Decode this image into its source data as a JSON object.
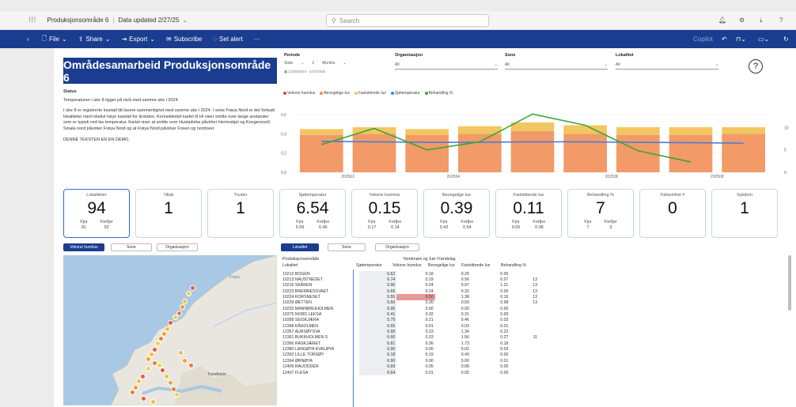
{
  "topbar": {
    "app_title": "Produksjonsområde 6",
    "data_updated": "Data updated 2/27/25",
    "search_placeholder": "Search"
  },
  "menubar": {
    "file": "File",
    "share": "Share",
    "export": "Export",
    "subscribe": "Subscribe",
    "set_alert": "Set alert",
    "more": "···",
    "copilot": "Copilot"
  },
  "report": {
    "title": "Områdesamarbeid Produksjonsområde 6",
    "help": "?",
    "status_heading": "Status",
    "status_line1": "Temperaturen i uke 8 ligger på nivå med samme uke i 2024.",
    "status_para": "I uke 8 er registrerte lusetall litt lavere sammenlignet med samme uke i 2024. I sone Frøya Nord er det fortsatt lokaliteter med relativt høye lusetall for årstiden. Konnektivitet kartet til HI viser smitte over lange avstander som er typisk ved lav temperatur. Kartet viser at smitte over Hustadvika påvirker Hemnskjel og Kongensvoll. Smala nord påvirker Frøya Nord og at Frøya Nord påvirker Fosen og nordover.",
    "status_demo": "DENNE TEKSTEN ER EN DEMO."
  },
  "slicers": {
    "periode": {
      "label": "Periode",
      "unit": "Siste",
      "num": "2",
      "span": "Months",
      "range": "12/28/2024 - 2/27/2025"
    },
    "organisasjon": {
      "label": "Organisasjon",
      "value": "All"
    },
    "sone": {
      "label": "Sone",
      "value": "All"
    },
    "lokalitet": {
      "label": "Lokalitet",
      "value": "All"
    }
  },
  "chart_data": {
    "type": "bar",
    "legend": [
      "Voksne hunnlus",
      "Bevegelige lus",
      "Fastsittende lus",
      "Sjøtemperatur",
      "Behandling %"
    ],
    "colors": {
      "voksne": "#e8413b",
      "bevegelige": "#f0884e",
      "fastsittende": "#f2c660",
      "temp": "#4a7fd6",
      "behandling": "#3aa63a"
    },
    "categories": [
      "202502a",
      "202502b",
      "202503a",
      "202503b",
      "202504a",
      "202504b",
      "202505a",
      "202505b",
      "202506a"
    ],
    "x_tick_labels": [
      "202502",
      "",
      "202504",
      "",
      "",
      "202506",
      "",
      "202508",
      ""
    ],
    "left_axis_ticks": [
      "0.6",
      "0.4",
      "0.2",
      "0.0"
    ],
    "right_axis_ticks": [
      "10",
      "5",
      "0"
    ],
    "ylim_left": [
      0,
      0.7
    ],
    "ylim_right": [
      0,
      15
    ],
    "series": [
      {
        "name": "Bevegelige lus",
        "values": [
          0.39,
          0.4,
          0.39,
          0.4,
          0.43,
          0.4,
          0.39,
          0.39,
          0.4
        ]
      },
      {
        "name": "Fastsittende lus",
        "values": [
          0.06,
          0.07,
          0.06,
          0.08,
          0.09,
          0.09,
          0.08,
          0.08,
          0.07
        ]
      },
      {
        "name": "Sjøtemperatur",
        "values": [
          6.9,
          6.8,
          6.7,
          6.7,
          6.8,
          6.8,
          6.7,
          6.6,
          6.5
        ]
      },
      {
        "name": "Behandling %",
        "values": [
          6.2,
          9.8,
          5.0,
          6.8,
          13.0,
          10.5,
          4.8,
          2.3,
          null
        ]
      }
    ]
  },
  "kpis": [
    {
      "label": "Lokaliteter",
      "value": "94",
      "sub1_label": "Fjor",
      "sub1_val": "81",
      "sub2_label": "Forfjor",
      "sub2_val": "92"
    },
    {
      "label": "Tiltak",
      "value": "1"
    },
    {
      "label": "Trusler",
      "value": "1"
    },
    {
      "label": "Sjøtemperatur",
      "value": "6.54",
      "sub1_label": "Fjor",
      "sub1_val": "5.99",
      "sub2_label": "Forfjor",
      "sub2_val": "6.46"
    },
    {
      "label": "Voksne hunnlus",
      "value": "0.15",
      "sub1_label": "Fjor",
      "sub1_val": "0.17",
      "sub2_label": "Forfjor",
      "sub2_val": "0.14"
    },
    {
      "label": "Bevegelige lus",
      "value": "0.39",
      "sub1_label": "Fjor",
      "sub1_val": "0.43",
      "sub2_label": "Forfjor",
      "sub2_val": "0.54"
    },
    {
      "label": "Fastsittende lus",
      "value": "0.11",
      "sub1_label": "Fjor",
      "sub1_val": "0.05",
      "sub2_label": "Forfjor",
      "sub2_val": "0.08"
    },
    {
      "label": "Behandling %",
      "value": "7",
      "sub1_label": "Fjor",
      "sub1_val": "7",
      "sub2_label": "Forfjor",
      "sub2_val": "3"
    },
    {
      "label": "Følsomhet #",
      "value": "0"
    },
    {
      "label": "Sykdom",
      "value": "1"
    }
  ],
  "map_tabs": [
    "Voksne hunnlus",
    "Sone",
    "Organisasjon"
  ],
  "table_tabs": [
    "Lokalitet",
    "Sone",
    "Organisasjon"
  ],
  "table": {
    "h1": "Produksjonsområde",
    "h1b": "Nordmøre og Sør-Trøndelag",
    "h2": "Lokalitet",
    "columns": [
      "Sjøtemperatur",
      "Voksne hunnlus",
      "Bevegelige lus",
      "Fastsittende lus",
      "Behandling %"
    ],
    "rows": [
      [
        "10212 BOGEN",
        "6.62",
        "0.18",
        "0.29",
        "0.00",
        ""
      ],
      [
        "10213 NAUSTNESET",
        "6.74",
        "0.19",
        "0.56",
        "0.07",
        "13"
      ],
      [
        "10216 SKÅREN",
        "5.96",
        "0.24",
        "0.97",
        "1.31",
        "13"
      ],
      [
        "10223 BREMNESSVAET",
        "6.69",
        "0.24",
        "0.32",
        "0.00",
        "13"
      ],
      [
        "10224 KORSNESET",
        "5.55",
        "0.50",
        "1.38",
        "0.16",
        "13"
      ],
      [
        "10229 ØETTEN",
        "5.60",
        "0.30",
        "0.59",
        "0.98",
        "13"
      ],
      [
        "10232 MANNBRUHOLMEN",
        "6.95",
        "0.00",
        "0.00",
        "0.00",
        ""
      ],
      [
        "10375 NORD LEKSA",
        "6.41",
        "0.32",
        "0.31",
        "0.00",
        ""
      ],
      [
        "10398 SEISKJÆRA",
        "5.79",
        "0.21",
        "0.46",
        "0.03",
        ""
      ],
      [
        "12348 KÅHOLMEN",
        "6.55",
        "0.01",
        "0.03",
        "0.01",
        ""
      ],
      [
        "12357 AURSØYSVA",
        "6.99",
        "0.23",
        "1.34",
        "0.22",
        ""
      ],
      [
        "12361 BUKKHOLMEN S",
        "6.60",
        "0.33",
        "1.56",
        "0.27",
        "11"
      ],
      [
        "12366 RASKJÆRET",
        "6.81",
        "0.36",
        "1.73",
        "0.18",
        ""
      ],
      [
        "12380 LANGØYA KVALØYA",
        "6.90",
        "0.00",
        "0.02",
        "0.03",
        ""
      ],
      [
        "12392 LILLE TORSØY",
        "6.18",
        "0.19",
        "0.43",
        "0.00",
        ""
      ],
      [
        "12394 ØRNØYA",
        "6.90",
        "0.00",
        "0.00",
        "0.01",
        ""
      ],
      [
        "12406 RAUODDEN",
        "6.69",
        "0.05",
        "0.08",
        "0.00",
        ""
      ],
      [
        "12407 FLESA",
        "6.64",
        "0.01",
        "0.05",
        "0.00",
        ""
      ]
    ]
  },
  "map_labels": {
    "sea": "Frøya",
    "town": "Trondheim"
  }
}
